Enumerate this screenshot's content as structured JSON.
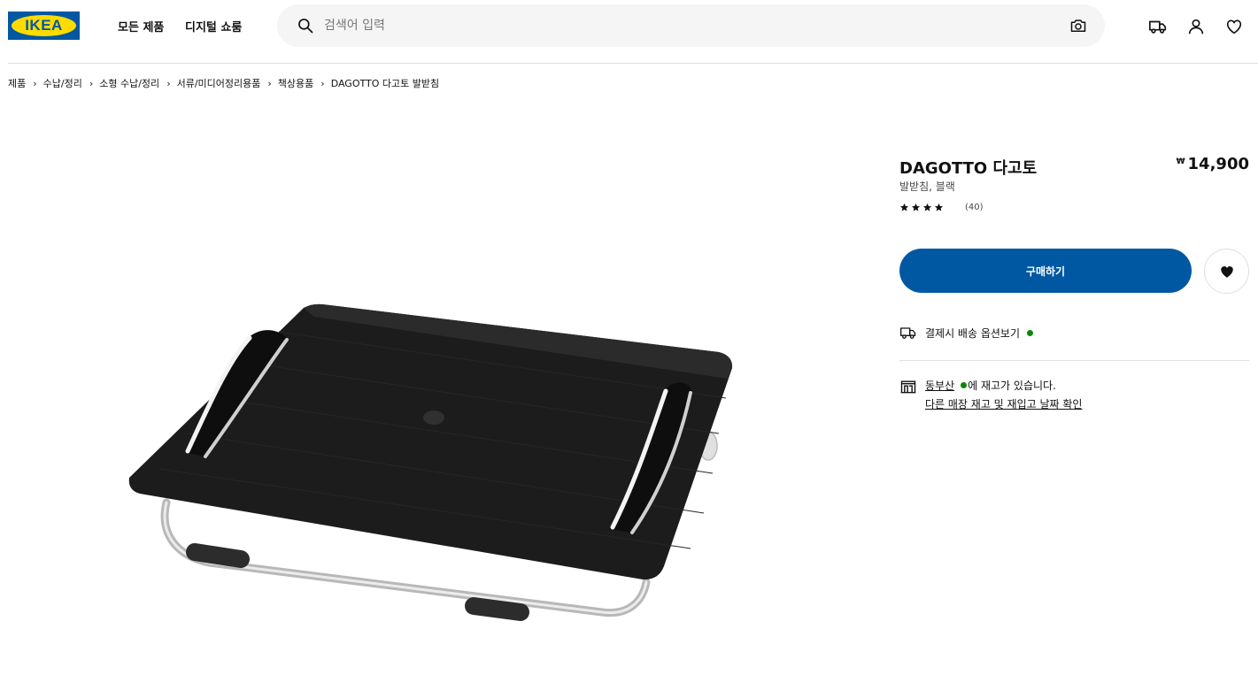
{
  "header": {
    "logo_text": "IKEA",
    "nav": [
      "모든 제품",
      "디지털 쇼룸"
    ],
    "search_placeholder": "검색어 입력"
  },
  "breadcrumb": [
    "제품",
    "수납/정리",
    "소형 수납/정리",
    "서류/미디어정리용품",
    "책상용품",
    "DAGOTTO 다고토 발받침"
  ],
  "product": {
    "name": "DAGOTTO 다고토",
    "description": "발받침, 블랙",
    "currency_symbol": "₩",
    "price": "14,900",
    "rating": 4,
    "rating_max": 5,
    "review_count": "(40)",
    "buy_label": "구매하기",
    "delivery_text": "결제시 배송 옵션보기",
    "store_name": "동부산",
    "stock_text": "에 재고가 있습니다.",
    "other_stores_link": "다른 매장 재고 및 재입고 날짜 확인"
  },
  "colors": {
    "brand_blue": "#0058a3",
    "brand_yellow": "#ffdb00",
    "stock_green": "#0a8a00"
  },
  "icons": [
    "search-icon",
    "camera-icon",
    "truck-icon",
    "user-icon",
    "heart-icon",
    "star-icon",
    "store-icon"
  ]
}
